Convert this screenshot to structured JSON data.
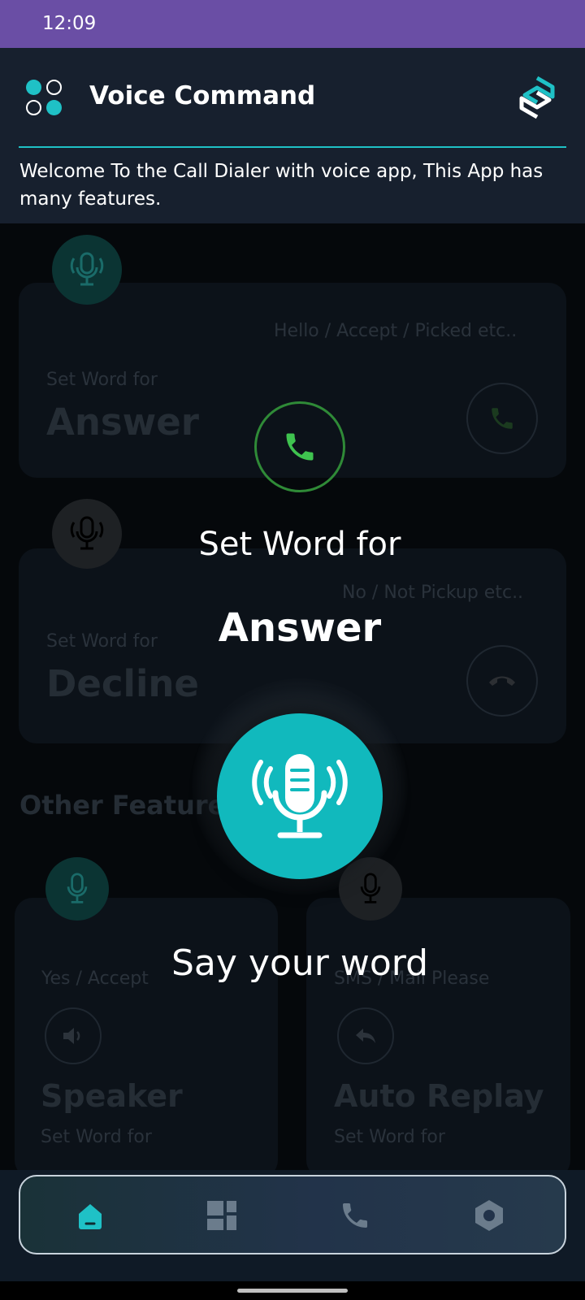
{
  "status_bar": {
    "time": "12:09"
  },
  "header": {
    "title": "Voice Command",
    "welcome": "Welcome To the Call Dialer with voice app, This App has many features."
  },
  "cards": {
    "answer": {
      "hint": "Hello / Accept / Picked etc..",
      "set_label": "Set Word for",
      "name": "Answer"
    },
    "decline": {
      "hint": "No / Not Pickup etc..",
      "set_label": "Set Word for",
      "name": "Decline"
    }
  },
  "other_features": {
    "title": "Other Features",
    "speaker": {
      "hint": "Yes / Accept",
      "name": "Speaker",
      "set_label": "Set Word for"
    },
    "auto_replay": {
      "hint": "SMS / Mail Please",
      "name": "Auto Replay",
      "set_label": "Set Word for"
    }
  },
  "dialog": {
    "set_label": "Set Word for",
    "word_name": "Answer",
    "prompt": "Say your word"
  },
  "bottom_nav": {
    "items": [
      {
        "icon": "home-icon",
        "active": true
      },
      {
        "icon": "dashboard-icon",
        "active": false
      },
      {
        "icon": "phone-icon",
        "active": false
      },
      {
        "icon": "settings-icon",
        "active": false
      }
    ]
  },
  "colors": {
    "status_bar": "#6a4ea5",
    "header_bg": "#17202e",
    "accent": "#11b9bd",
    "call_green": "#3fc34f",
    "nav_active": "#1fc1c6"
  }
}
